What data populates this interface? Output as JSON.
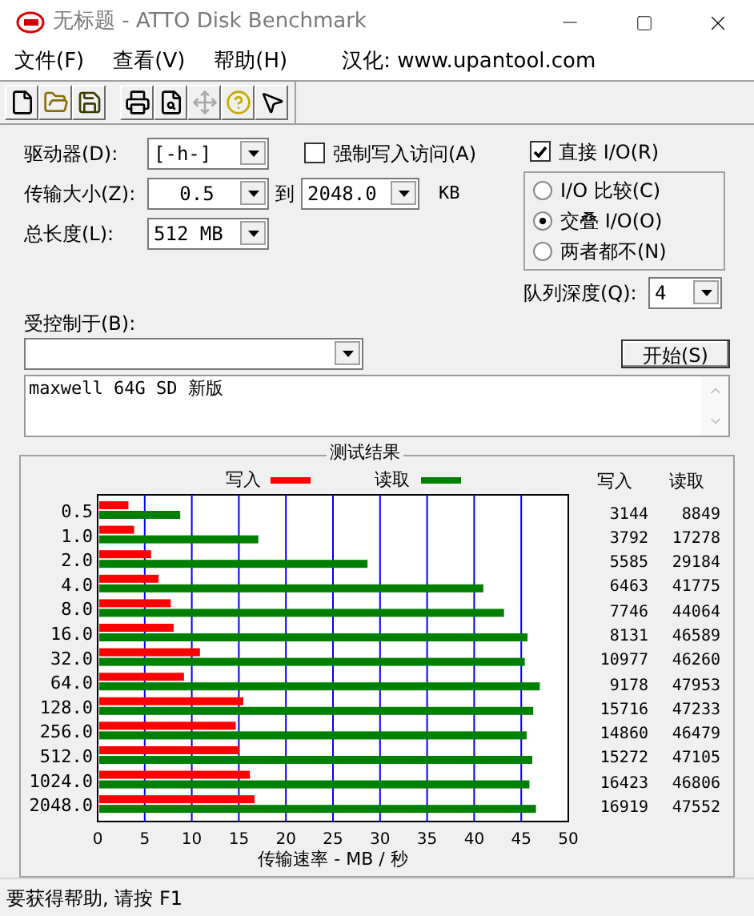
{
  "window": {
    "title": "无标题 - ATTO Disk Benchmark"
  },
  "menu": [
    "文件(F)",
    "查看(V)",
    "帮助(H)",
    "汉化: www.upantool.com"
  ],
  "toolbar": [
    {
      "kind": "new",
      "disabled": false
    },
    {
      "kind": "open",
      "disabled": false
    },
    {
      "kind": "save",
      "disabled": false
    },
    {
      "kind": "print",
      "disabled": false
    },
    {
      "kind": "preview",
      "disabled": false
    },
    {
      "kind": "move",
      "disabled": true
    },
    {
      "kind": "help",
      "disabled": false
    },
    {
      "kind": "context-help",
      "disabled": false
    }
  ],
  "form": {
    "drive": {
      "label": "驱动器(D):",
      "value": "[-h-]"
    },
    "transfer_size": {
      "label": "传输大小(Z):",
      "from": "0.5",
      "to_label": "到",
      "to": "2048.0",
      "unit": "KB"
    },
    "total_length": {
      "label": "总长度(L):",
      "value": "512 MB"
    },
    "force_write": {
      "label": "强制写入访问(A)",
      "checked": false
    },
    "direct_io": {
      "label": "直接 I/O(R)",
      "checked": true
    },
    "io_mode": [
      {
        "label": "I/O 比较(C)",
        "selected": false
      },
      {
        "label": "交叠 I/O(O)",
        "selected": true
      },
      {
        "label": "两者都不(N)",
        "selected": false
      }
    ],
    "queue_depth": {
      "label": "队列深度(Q):",
      "value": "4"
    },
    "controlled_by": {
      "label": "受控制于(B):"
    },
    "start_button": "开始(S)",
    "description": "maxwell 64G SD 新版"
  },
  "results": {
    "title": "测试结果",
    "columns": [
      "写入",
      "读取"
    ],
    "rows": [
      {
        "write": "3144",
        "read": "8849"
      },
      {
        "write": "3792",
        "read": "17278"
      },
      {
        "write": "5585",
        "read": "29184"
      },
      {
        "write": "6463",
        "read": "41775"
      },
      {
        "write": "7746",
        "read": "44064"
      },
      {
        "write": "8131",
        "read": "46589"
      },
      {
        "write": "10977",
        "read": "46260"
      },
      {
        "write": "9178",
        "read": "47953"
      },
      {
        "write": "15716",
        "read": "47233"
      },
      {
        "write": "14860",
        "read": "46479"
      },
      {
        "write": "15272",
        "read": "47105"
      },
      {
        "write": "16423",
        "read": "46806"
      },
      {
        "write": "16919",
        "read": "47552"
      }
    ],
    "chart_data": {
      "type": "bar",
      "orientation": "horizontal",
      "xlabel": "传输速率 - MB / 秒",
      "categories": [
        "0.5",
        "1.0",
        "2.0",
        "4.0",
        "8.0",
        "16.0",
        "32.0",
        "64.0",
        "128.0",
        "256.0",
        "512.0",
        "1024.0",
        "2048.0"
      ],
      "series": [
        {
          "name": "写入",
          "color": "#ff0000",
          "values": [
            3.1,
            3.7,
            5.5,
            6.3,
            7.6,
            7.9,
            10.7,
            9.0,
            15.3,
            14.5,
            14.9,
            16.0,
            16.5
          ]
        },
        {
          "name": "读取",
          "color": "#008000",
          "values": [
            8.6,
            16.9,
            28.5,
            40.8,
            43.0,
            45.5,
            45.2,
            46.8,
            46.1,
            45.4,
            46.0,
            45.7,
            46.4
          ]
        }
      ],
      "grid": true,
      "legend": true,
      "xlim": [
        0,
        50
      ],
      "xticks": [
        0,
        5,
        10,
        15,
        20,
        25,
        30,
        35,
        40,
        45,
        50
      ]
    }
  },
  "status_bar": "要获得帮助, 请按 F1"
}
